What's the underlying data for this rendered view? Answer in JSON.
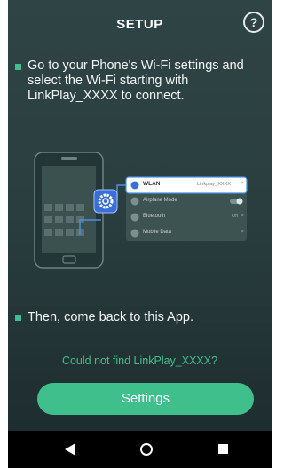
{
  "header": {
    "title": "SETUP",
    "help_icon": "?"
  },
  "steps": [
    {
      "text": "Go to your Phone's Wi-Fi settings and select the Wi-Fi starting with LinkPlay_XXXX to connect."
    },
    {
      "text": "Then, come back to this App."
    }
  ],
  "illustration": {
    "settings_list": [
      {
        "label": "WLAN",
        "value": "Linkplay_XXXX",
        "arrow": ">"
      },
      {
        "label": "Airplane Mode",
        "value": "",
        "arrow": ""
      },
      {
        "label": "Bluetooth",
        "value": "On",
        "arrow": ">"
      },
      {
        "label": "Mobile Data",
        "value": "",
        "arrow": ">"
      }
    ]
  },
  "link": {
    "text": "Could not find LinkPlay_XXXX?"
  },
  "button": {
    "label": "Settings"
  },
  "colors": {
    "accent": "#3fbf8c",
    "background": "#2a3e3f",
    "highlight": "#3a6fd8"
  }
}
